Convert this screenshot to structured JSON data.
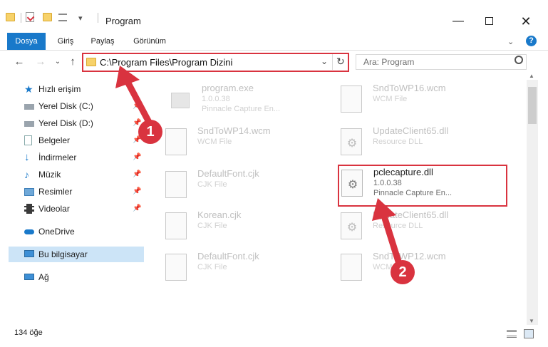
{
  "window": {
    "title": "Program",
    "qat_arrow": "▾"
  },
  "ribbon": {
    "tabs": [
      "Dosya",
      "Giriş",
      "Paylaş",
      "Görünüm"
    ]
  },
  "nav": {
    "address_path": "C:\\Program Files\\Program Dizini",
    "search_placeholder": "Ara: Program"
  },
  "nav_pane": {
    "quick_access": "Hızlı erişim",
    "items": [
      {
        "label": "Yerel Disk (C:)",
        "icon": "drive-icon",
        "pinned": true
      },
      {
        "label": "Yerel Disk (D:)",
        "icon": "drive-icon",
        "pinned": true
      },
      {
        "label": "Belgeler",
        "icon": "documents-icon",
        "pinned": true
      },
      {
        "label": "İndirmeler",
        "icon": "download-icon",
        "pinned": true
      },
      {
        "label": "Müzik",
        "icon": "music-icon",
        "pinned": true
      },
      {
        "label": "Resimler",
        "icon": "pictures-icon",
        "pinned": true
      },
      {
        "label": "Videolar",
        "icon": "video-icon",
        "pinned": true
      }
    ],
    "onedrive": "OneDrive",
    "this_pc": "Bu bilgisayar",
    "network": "Ağ"
  },
  "files": [
    {
      "name": "program.exe",
      "line1": "1.0.0.38",
      "line2": "Pinnacle Capture En..."
    },
    {
      "name": "SndToWP16.wcm",
      "line1": "WCM File",
      "line2": ""
    },
    {
      "name": "SndToWP14.wcm",
      "line1": "WCM File",
      "line2": ""
    },
    {
      "name": "UpdateClient65.dll",
      "line1": "Resource DLL",
      "line2": ""
    },
    {
      "name": "DefaultFont.cjk",
      "line1": "CJK File",
      "line2": ""
    },
    {
      "name": "pclecapture.dll",
      "line1": "1.0.0.38",
      "line2": "Pinnacle Capture En..."
    },
    {
      "name": "Korean.cjk",
      "line1": "CJK File",
      "line2": ""
    },
    {
      "name": "UpdateClient65.dll",
      "line1": "Resource DLL",
      "line2": ""
    },
    {
      "name": "DefaultFont.cjk",
      "line1": "CJK File",
      "line2": ""
    },
    {
      "name": "SndToWP12.wcm",
      "line1": "WCM File",
      "line2": ""
    }
  ],
  "status": {
    "item_count": "134 öğe"
  },
  "annotations": {
    "badge1": "1",
    "badge2": "2"
  },
  "colors": {
    "accent": "#1979ca",
    "highlight": "#d9333f",
    "selection": "#cce4f7"
  }
}
